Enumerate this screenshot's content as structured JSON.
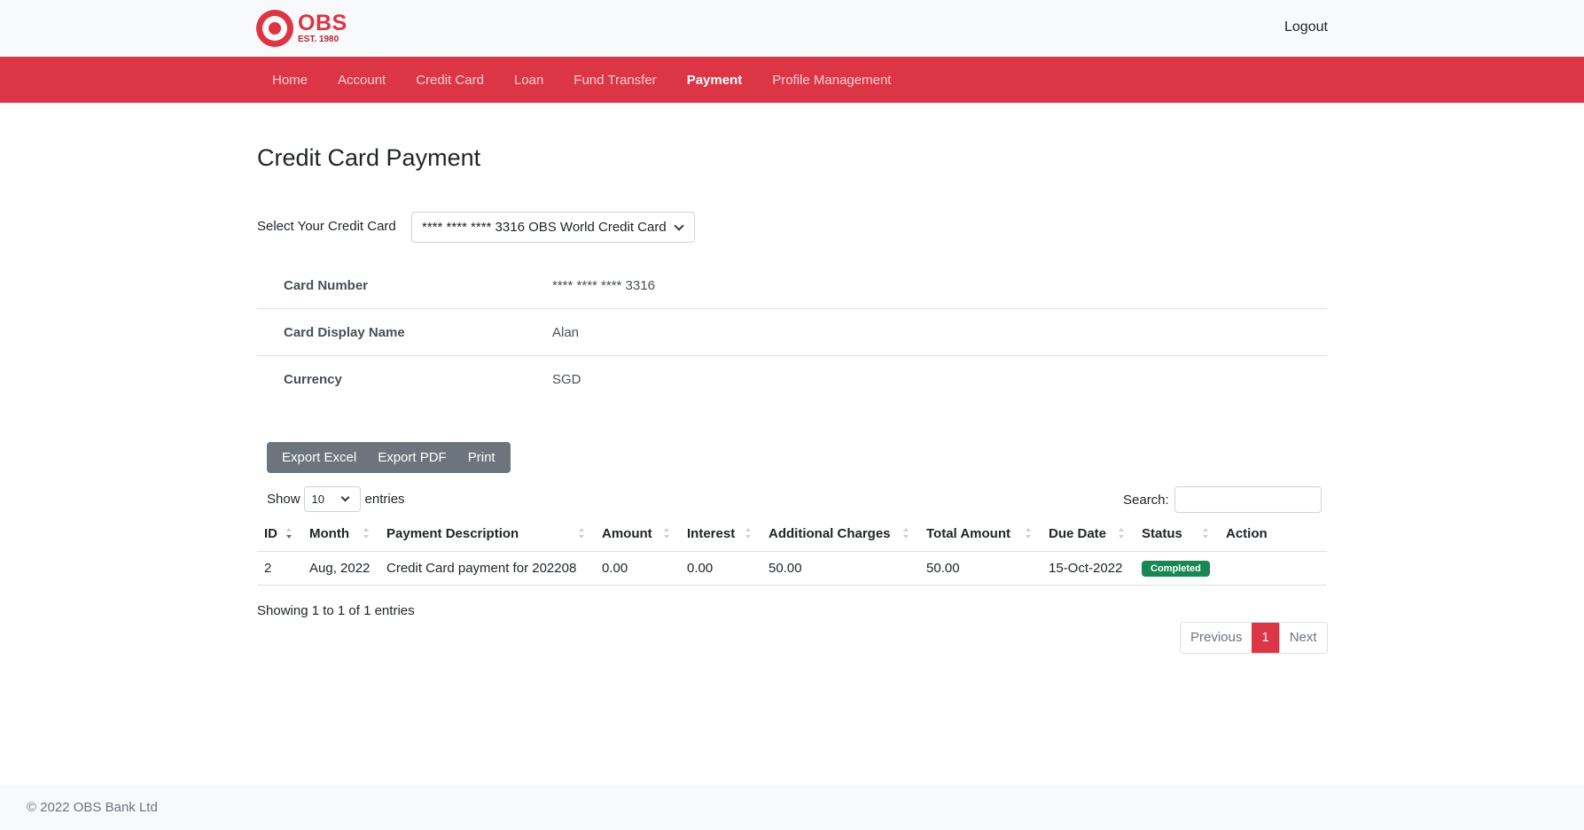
{
  "header": {
    "logo_name": "OBS",
    "logo_est": "EST. 1980",
    "logout_label": "Logout"
  },
  "nav": {
    "items": [
      {
        "label": "Home"
      },
      {
        "label": "Account"
      },
      {
        "label": "Credit Card"
      },
      {
        "label": "Loan"
      },
      {
        "label": "Fund Transfer"
      },
      {
        "label": "Payment"
      },
      {
        "label": "Profile Management"
      }
    ],
    "active": "Payment"
  },
  "page": {
    "title": "Credit Card Payment",
    "select_label": "Select Your Credit Card",
    "selected_card": "**** **** **** 3316 OBS World Credit Card"
  },
  "card_info": [
    {
      "key": "Card Number",
      "value": "**** **** **** 3316"
    },
    {
      "key": "Card Display Name",
      "value": "Alan"
    },
    {
      "key": "Currency",
      "value": "SGD"
    }
  ],
  "toolbar": {
    "export_excel": "Export Excel",
    "export_pdf": "Export PDF",
    "print": "Print"
  },
  "table_controls": {
    "show_label": "Show",
    "entries_value": "10",
    "entries_label": "entries",
    "search_label": "Search:",
    "search_value": ""
  },
  "table": {
    "headers": [
      "ID",
      "Month",
      "Payment Description",
      "Amount",
      "Interest",
      "Additional Charges",
      "Total Amount",
      "Due Date",
      "Status",
      "Action"
    ],
    "rows": [
      {
        "id": "2",
        "month": "Aug, 2022",
        "description": "Credit Card payment for 202208",
        "amount": "0.00",
        "interest": "0.00",
        "additional_charges": "50.00",
        "total_amount": "50.00",
        "due_date": "15-Oct-2022",
        "status": "Completed",
        "action": ""
      }
    ]
  },
  "table_info": "Showing 1 to 1 of 1 entries",
  "pagination": {
    "previous": "Previous",
    "current": "1",
    "next": "Next"
  },
  "footer": {
    "text": "© 2022 OBS Bank Ltd"
  },
  "colors": {
    "brand_red": "#dc3545",
    "status_green": "#198754",
    "button_gray": "#6c757d"
  }
}
